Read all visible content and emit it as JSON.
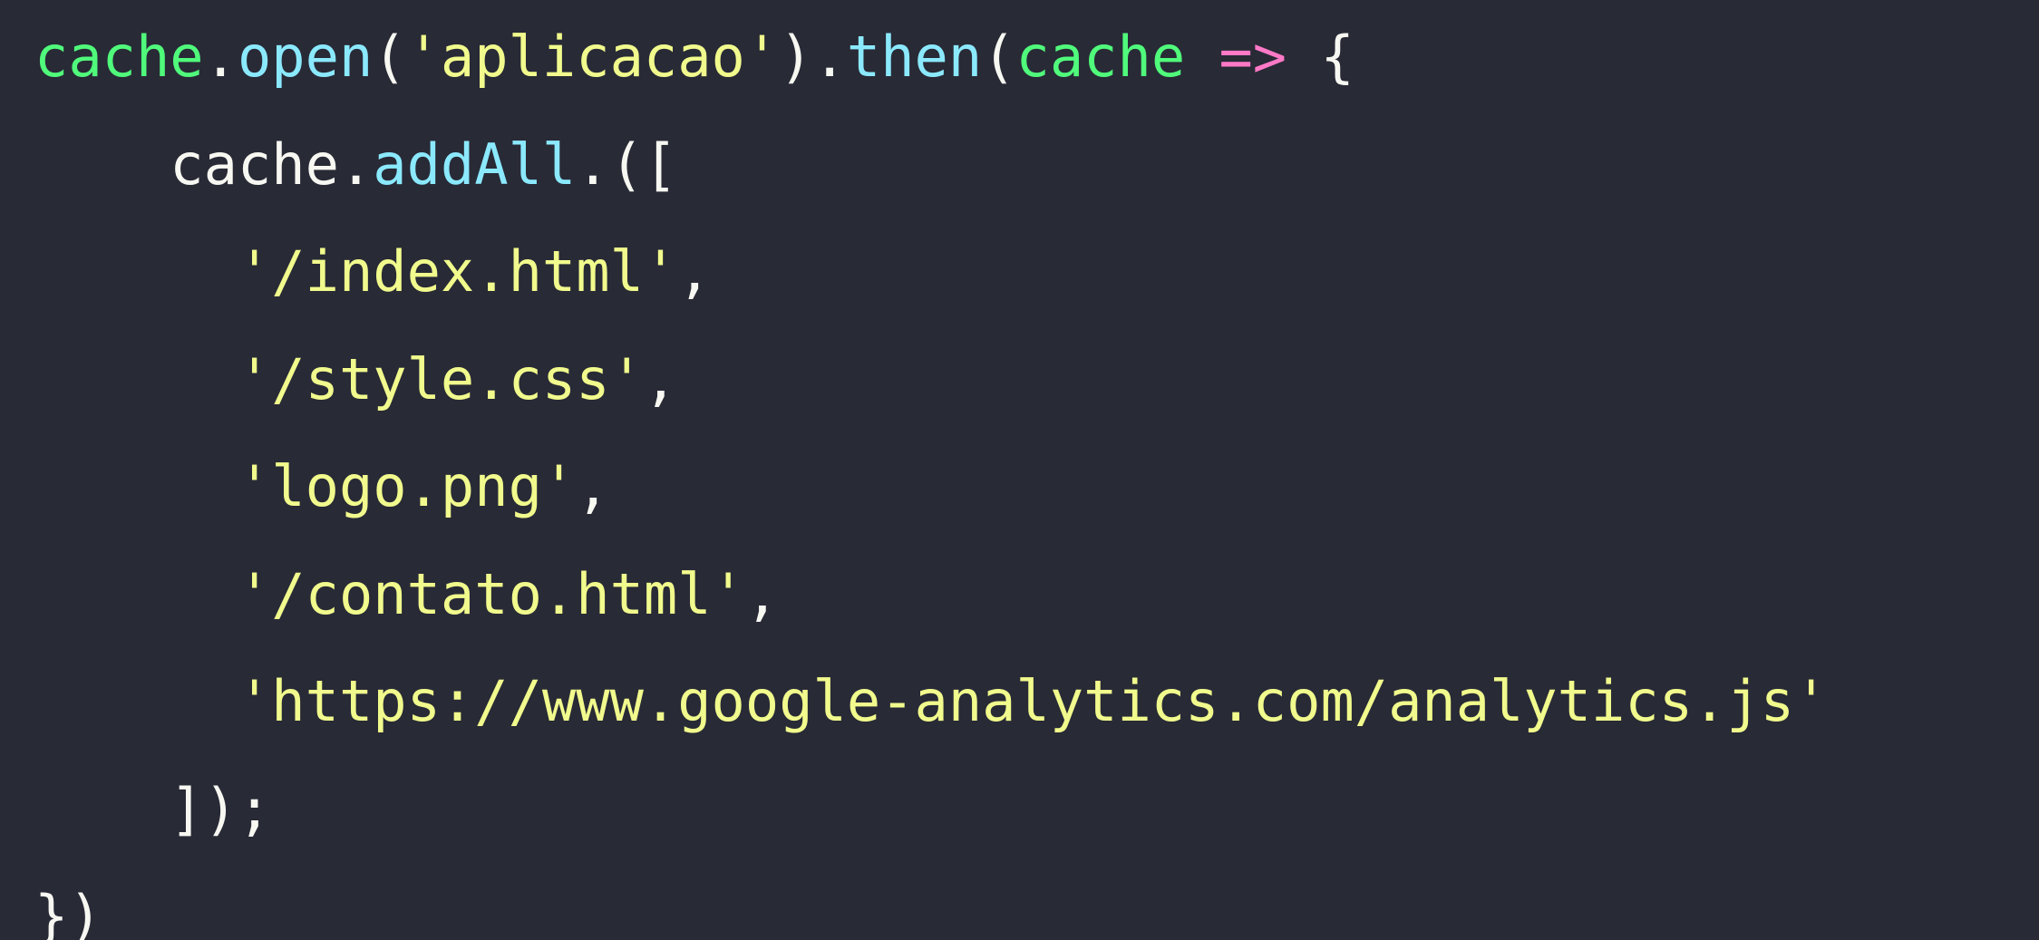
{
  "code": {
    "lines": [
      {
        "tokens": [
          {
            "text": "cache",
            "kind": "var"
          },
          {
            "text": ".",
            "kind": "plain"
          },
          {
            "text": "open",
            "kind": "fn"
          },
          {
            "text": "(",
            "kind": "plain"
          },
          {
            "text": "'aplicacao'",
            "kind": "str"
          },
          {
            "text": ").",
            "kind": "plain"
          },
          {
            "text": "then",
            "kind": "fn"
          },
          {
            "text": "(",
            "kind": "plain"
          },
          {
            "text": "cache",
            "kind": "var"
          },
          {
            "text": " ",
            "kind": "plain"
          },
          {
            "text": "=>",
            "kind": "op"
          },
          {
            "text": " {",
            "kind": "plain"
          }
        ]
      },
      {
        "tokens": [
          {
            "text": "    cache.",
            "kind": "plain"
          },
          {
            "text": "addAll",
            "kind": "fn"
          },
          {
            "text": ".([",
            "kind": "plain"
          }
        ]
      },
      {
        "tokens": [
          {
            "text": "      ",
            "kind": "plain"
          },
          {
            "text": "'/index.html'",
            "kind": "str"
          },
          {
            "text": ",",
            "kind": "plain"
          }
        ]
      },
      {
        "tokens": [
          {
            "text": "      ",
            "kind": "plain"
          },
          {
            "text": "'/style.css'",
            "kind": "str"
          },
          {
            "text": ",",
            "kind": "plain"
          }
        ]
      },
      {
        "tokens": [
          {
            "text": "      ",
            "kind": "plain"
          },
          {
            "text": "'logo.png'",
            "kind": "str"
          },
          {
            "text": ",",
            "kind": "plain"
          }
        ]
      },
      {
        "tokens": [
          {
            "text": "      ",
            "kind": "plain"
          },
          {
            "text": "'/contato.html'",
            "kind": "str"
          },
          {
            "text": ",",
            "kind": "plain"
          }
        ]
      },
      {
        "tokens": [
          {
            "text": "      ",
            "kind": "plain"
          },
          {
            "text": "'https://www.google-analytics.com/analytics.js'",
            "kind": "str"
          }
        ]
      },
      {
        "tokens": [
          {
            "text": "    ]);",
            "kind": "plain"
          }
        ]
      },
      {
        "tokens": [
          {
            "text": "})",
            "kind": "plain"
          }
        ]
      }
    ]
  },
  "colors": {
    "background": "#282a36",
    "var": "#50fa7b",
    "fn": "#8be9fd",
    "str": "#f1fa8c",
    "op": "#ff79c6",
    "plain": "#f8f8f2"
  }
}
